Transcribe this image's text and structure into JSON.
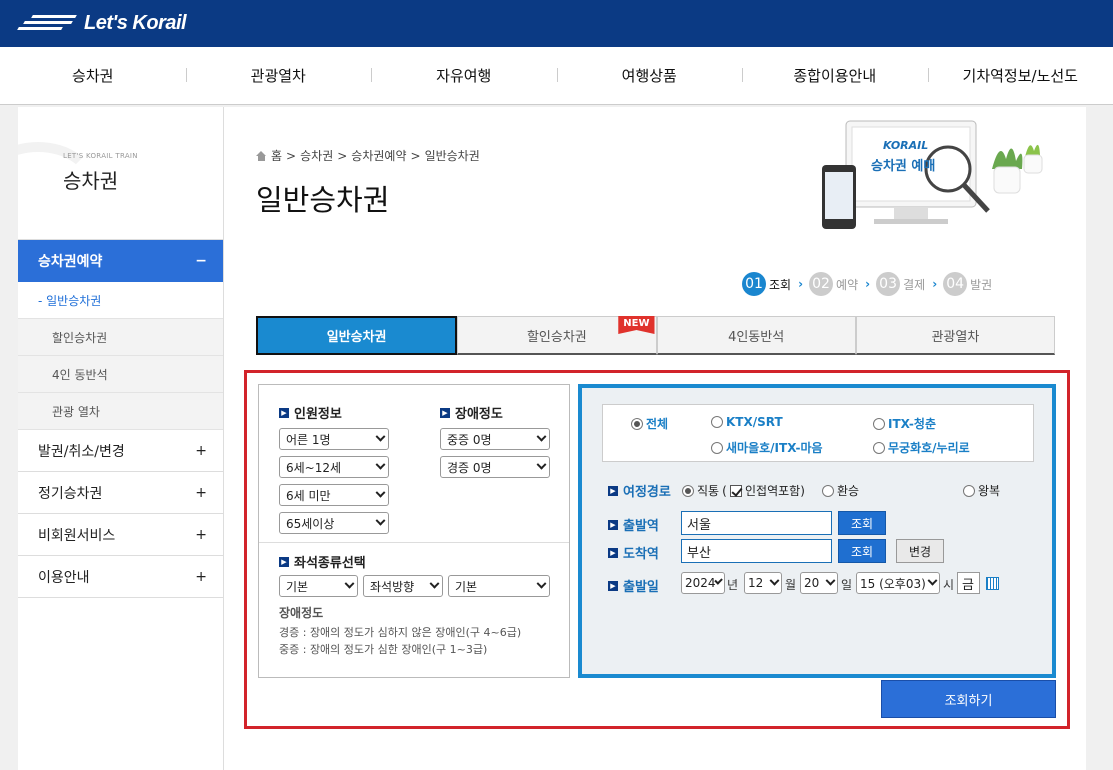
{
  "brand": {
    "name": "Let's Korail"
  },
  "nav": [
    "승차권",
    "관광열차",
    "자유여행",
    "여행상품",
    "종합이용안내",
    "기차역정보/노선도"
  ],
  "lnb": {
    "sub": "LET'S KORAIL TRAIN",
    "title": "승차권",
    "active": {
      "label": "승차권예약",
      "toggle": "−"
    },
    "subitems": [
      "- 일반승차권",
      "할인승차권",
      "4인 동반석",
      "관광 열차"
    ],
    "items": [
      {
        "label": "발권/취소/변경",
        "toggle": "+"
      },
      {
        "label": "정기승차권",
        "toggle": "+"
      },
      {
        "label": "비회원서비스",
        "toggle": "+"
      },
      {
        "label": "이용안내",
        "toggle": "+"
      }
    ]
  },
  "breadcrumb": [
    "홈",
    ">",
    "승차권",
    ">",
    "승차권예약",
    ">",
    "일반승차권"
  ],
  "page_title": "일반승차권",
  "hero": {
    "brand": "KORAIL",
    "caption": "승차권 예매"
  },
  "steps": [
    {
      "n": "01",
      "label": "조회"
    },
    {
      "n": "02",
      "label": "예약"
    },
    {
      "n": "03",
      "label": "결제"
    },
    {
      "n": "04",
      "label": "발권"
    }
  ],
  "step_arrow": "›",
  "tabs": [
    "일반승차권",
    "할인승차권",
    "4인동반석",
    "관광열차"
  ],
  "new_badge": "NEW",
  "passengers": {
    "label": "인원정보",
    "selects": [
      "어른 1명",
      "6세~12세",
      "6세 미만",
      "65세이상"
    ]
  },
  "disability": {
    "label": "장애정도",
    "selects": [
      "중증 0명",
      "경증 0명"
    ]
  },
  "seat": {
    "label": "좌석종류선택",
    "selects": [
      "기본",
      "좌석방향",
      "기본"
    ]
  },
  "notes": {
    "title": "장애정도",
    "lines": [
      "경증 : 장애의 정도가 심하지 않은 장애인(구 4~6급)",
      "중증 : 장애의 정도가 심한 장애인(구 1~3급)"
    ]
  },
  "train_types": [
    "전체",
    "KTX/SRT",
    "ITX-청춘",
    "새마을호/ITX-마음",
    "무궁화호/누리로"
  ],
  "route": {
    "label": "여정경로",
    "options": [
      "직통",
      "(",
      "인접역포함)",
      "환승",
      "왕복"
    ]
  },
  "depart": {
    "label": "출발역",
    "value": "서울",
    "button": "조회"
  },
  "arrive": {
    "label": "도착역",
    "value": "부산",
    "button": "조회",
    "change": "변경"
  },
  "date": {
    "label": "출발일",
    "year": "2024",
    "year_unit": "년",
    "month": "12",
    "month_unit": "월",
    "day": "20",
    "day_unit": "일",
    "hour": "15 (오후03)",
    "hour_unit": "시",
    "weekday": "금"
  },
  "search_button": "조회하기",
  "colors": {
    "nav_bg": "#0b3a84",
    "accent": "#1a8ad0",
    "active_blue": "#2b6fd8",
    "red_frame": "#d2232a",
    "new": "#e0322c"
  }
}
